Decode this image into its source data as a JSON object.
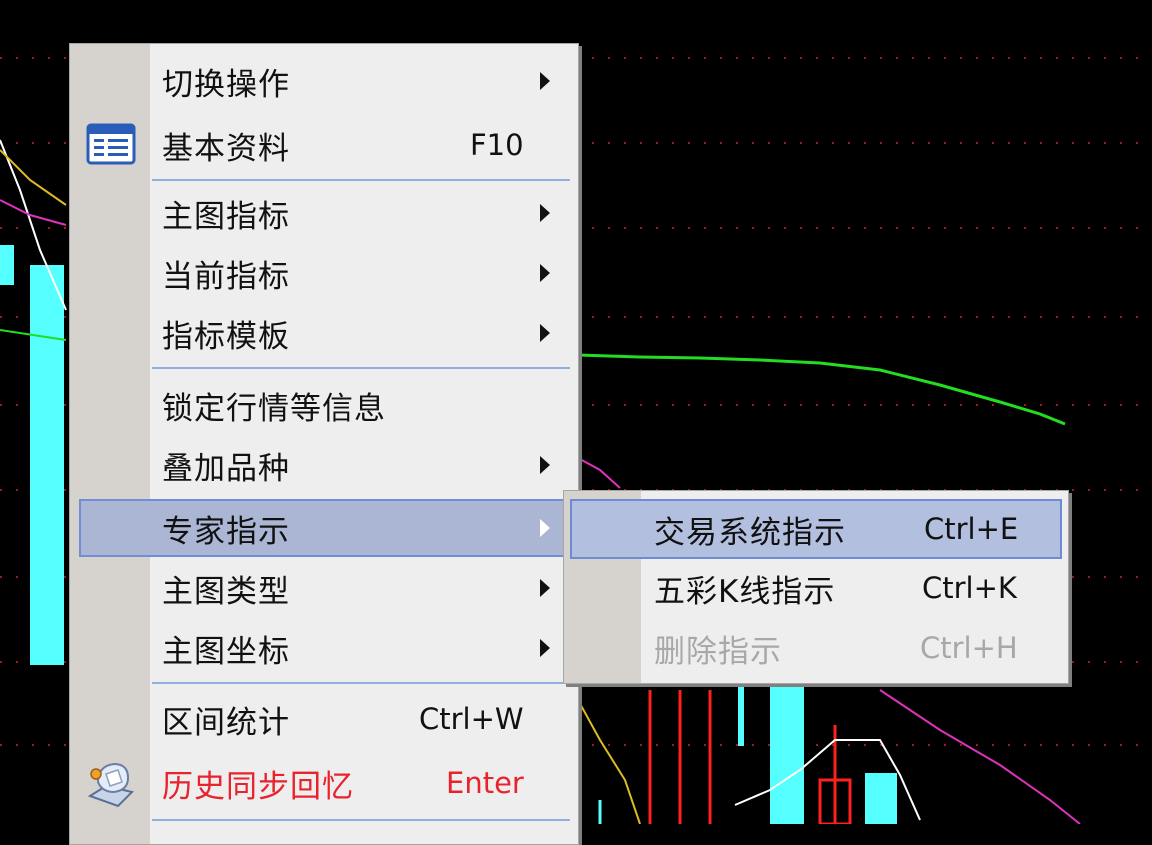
{
  "context_menu": {
    "items": [
      {
        "label": "切换操作",
        "shortcut": "",
        "submenu": true
      },
      {
        "label": "基本资料",
        "shortcut": "F10",
        "submenu": false,
        "icon": "info-sheet-icon"
      },
      {
        "label": "主图指标",
        "shortcut": "",
        "submenu": true
      },
      {
        "label": "当前指标",
        "shortcut": "",
        "submenu": true
      },
      {
        "label": "指标模板",
        "shortcut": "",
        "submenu": true
      },
      {
        "label": "锁定行情等信息",
        "shortcut": "",
        "submenu": false
      },
      {
        "label": "叠加品种",
        "shortcut": "",
        "submenu": true
      },
      {
        "label": "专家指示",
        "shortcut": "",
        "submenu": true,
        "highlighted": true
      },
      {
        "label": "主图类型",
        "shortcut": "",
        "submenu": true
      },
      {
        "label": "主图坐标",
        "shortcut": "",
        "submenu": true
      },
      {
        "label": "区间统计",
        "shortcut": "Ctrl+W",
        "submenu": false
      },
      {
        "label": "历史同步回忆",
        "shortcut": "Enter",
        "submenu": false,
        "icon": "history-replay-icon",
        "color": "#e8232d"
      }
    ]
  },
  "submenu": {
    "items": [
      {
        "label": "交易系统指示",
        "shortcut": "Ctrl+E",
        "highlighted": true
      },
      {
        "label": "五彩K线指示",
        "shortcut": "Ctrl+K"
      },
      {
        "label": "删除指示",
        "shortcut": "Ctrl+H",
        "disabled": true
      }
    ]
  },
  "colors": {
    "background": "#000000",
    "menu_bg": "#efeeee",
    "highlight": "#aab6d4",
    "candle_up": "#ff2020",
    "candle_down": "#55ffff",
    "ma_green": "#22dd22",
    "ma_magenta": "#dd33bb",
    "ma_yellow": "#ddbb22",
    "ma_white": "#ffffff",
    "grid": "#aa2222"
  }
}
